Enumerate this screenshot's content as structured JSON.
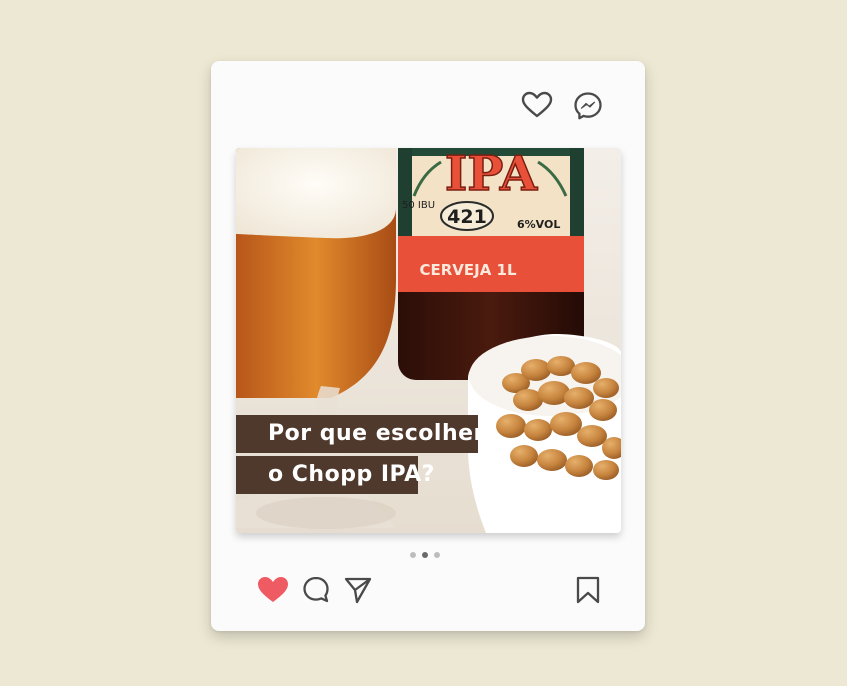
{
  "post": {
    "caption_line1": "Por que escolher",
    "caption_line2": "o Chopp IPA?",
    "carousel": {
      "count": 3,
      "active_index": 1
    }
  },
  "product_label": {
    "brand": "IPA",
    "number": "421",
    "ibu": "50 IBU",
    "abv": "6%VOL",
    "volume": "CERVEJA 1L"
  },
  "icons": {
    "top": [
      "heart-outline-icon",
      "messenger-icon"
    ],
    "actions": [
      "heart-filled-icon",
      "comment-icon",
      "share-icon"
    ],
    "save": "bookmark-icon"
  },
  "colors": {
    "background": "#ece8d3",
    "card": "#fbfbfb",
    "caption_bg": "#4f382c",
    "like_red": "#ef5b62",
    "label_orange": "#e8503a"
  }
}
